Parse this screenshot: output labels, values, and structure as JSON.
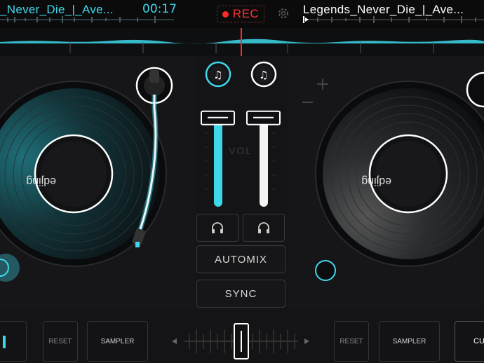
{
  "left_deck": {
    "title": "_Never_Die_|_Ave...",
    "time": "00:17",
    "label_text": "edjing",
    "reset_label": "RESET",
    "sampler_label": "SAMPLER"
  },
  "right_deck": {
    "title": "Legends_Never_Die_|_Ave...",
    "label_text": "edjing",
    "reset_label": "RESET",
    "sampler_label": "SAMPLER",
    "cue_label": "CU"
  },
  "toolbar": {
    "rec_label": "REC"
  },
  "mixer": {
    "vol_label": "VOL",
    "automix_label": "AUTOMIX",
    "sync_label": "SYNC",
    "left_volume": 0.85,
    "right_volume": 0.85,
    "crossfader": 0.5
  },
  "colors": {
    "accent": "#3ed7ea",
    "rec": "#ff3333",
    "background": "#141416"
  },
  "icons": [
    "music-note-icon",
    "headphones-icon",
    "gear-icon",
    "plus-icon",
    "minus-icon",
    "arrow-left-icon",
    "arrow-right-icon"
  ]
}
